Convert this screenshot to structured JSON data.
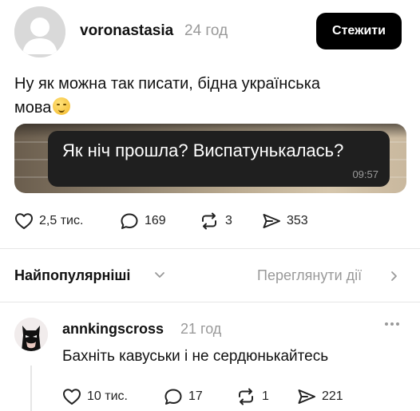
{
  "post": {
    "username": "voronastasia",
    "time": "24 год",
    "follow_label": "Стежити",
    "text_line1": "Ну як можна так писати, бідна українська",
    "text_line2": "мова",
    "emoji": "smiling-face-with-tear",
    "media": {
      "message_text": "Як ніч прошла? Виспатунькалась?",
      "message_time": "09:57"
    },
    "actions": {
      "likes": "2,5 тис.",
      "comments": "169",
      "reposts": "3",
      "shares": "353"
    }
  },
  "sort": {
    "label": "Найпопулярніші",
    "activity_link": "Переглянути дії"
  },
  "comment": {
    "username": "annkingscross",
    "time": "21 год",
    "text": "Бахніть кавуськи і не сердюнькайтесь",
    "actions": {
      "likes": "10 тис.",
      "comments": "17",
      "reposts": "1",
      "shares": "221"
    }
  }
}
